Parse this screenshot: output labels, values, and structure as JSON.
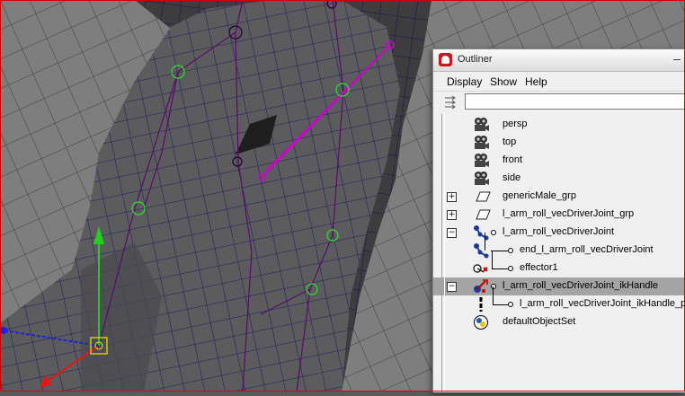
{
  "outliner": {
    "title": "Outliner",
    "minimize_glyph": "‒",
    "menu": [
      "Display",
      "Show",
      "Help"
    ],
    "filter": {
      "value": "",
      "placeholder": ""
    },
    "items": [
      {
        "label": "persp",
        "icon": "camera-icon",
        "expander": ""
      },
      {
        "label": "top",
        "icon": "camera-icon",
        "expander": ""
      },
      {
        "label": "front",
        "icon": "camera-icon",
        "expander": ""
      },
      {
        "label": "side",
        "icon": "camera-icon",
        "expander": ""
      },
      {
        "label": "genericMale_grp",
        "icon": "transform-icon",
        "expander": "+"
      },
      {
        "label": "l_arm_roll_vecDriverJoint_grp",
        "icon": "transform-icon",
        "expander": "+"
      },
      {
        "label": "l_arm_roll_vecDriverJoint",
        "icon": "joint-icon",
        "expander": "−"
      },
      {
        "label": "end_l_arm_roll_vecDriverJoint",
        "icon": "joint-icon",
        "expander": ""
      },
      {
        "label": "effector1",
        "icon": "effector-icon",
        "expander": ""
      },
      {
        "label": "l_arm_roll_vecDriverJoint_ikHandle",
        "icon": "ik-handle-icon",
        "expander": "−",
        "selected": true
      },
      {
        "label": "l_arm_roll_vecDriverJoint_ikHandle_po",
        "icon": "pole-vector-icon",
        "expander": ""
      },
      {
        "label": "defaultObjectSet",
        "icon": "set-icon",
        "expander": ""
      }
    ]
  },
  "colors": {
    "viewport_border": "#d40000",
    "mesh_face": "#5c5c5e",
    "wire": "#1c1d5a",
    "joint_green": "#2fd02f",
    "selected_joint": "#d100d1",
    "selected_row": "#a4a4a4"
  }
}
